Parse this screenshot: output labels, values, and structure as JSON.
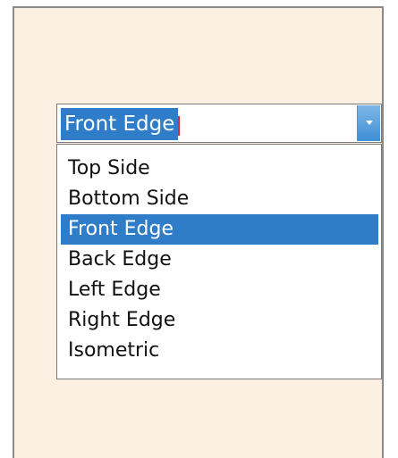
{
  "combo": {
    "selected_value": "Front Edge",
    "options": [
      {
        "label": "Top Side",
        "highlighted": false
      },
      {
        "label": "Bottom Side",
        "highlighted": false
      },
      {
        "label": "Front Edge",
        "highlighted": true
      },
      {
        "label": "Back Edge",
        "highlighted": false
      },
      {
        "label": "Left Edge",
        "highlighted": false
      },
      {
        "label": "Right Edge",
        "highlighted": false
      },
      {
        "label": "Isometric",
        "highlighted": false
      }
    ],
    "icon": "chevron-down-icon"
  },
  "colors": {
    "panel_background": "#fcf0e3",
    "highlight": "#2f7dc8",
    "caret": "#e0282a"
  }
}
